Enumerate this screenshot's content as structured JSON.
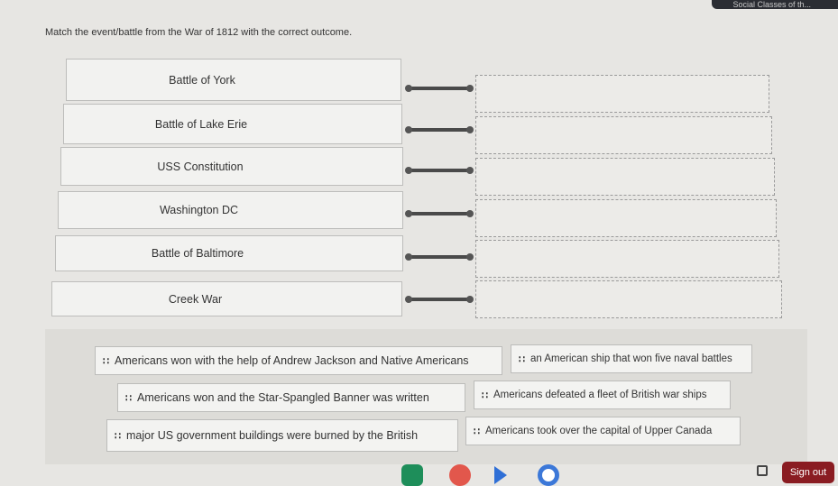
{
  "instructions": "Match the event/battle from the War of 1812 with the correct outcome.",
  "corner_text": "Social Classes of th...",
  "prompts": [
    "Battle of York",
    "Battle of Lake Erie",
    "USS Constitution",
    "Washington DC",
    "Battle of Baltimore",
    "Creek War"
  ],
  "answers": [
    "Americans won with the help of Andrew Jackson and Native Americans",
    "an American ship that won five naval battles",
    "Americans won and the Star-Spangled Banner was written",
    "Americans defeated a fleet of British war ships",
    "major US government buildings were burned by the British",
    "Americans took over the capital of Upper Canada"
  ],
  "grip_icon": "drag-handle-icon",
  "sign_out": "Sign out",
  "colors": {
    "sign_out_bg": "#8a1c22",
    "connector": "#4a4a4a"
  }
}
